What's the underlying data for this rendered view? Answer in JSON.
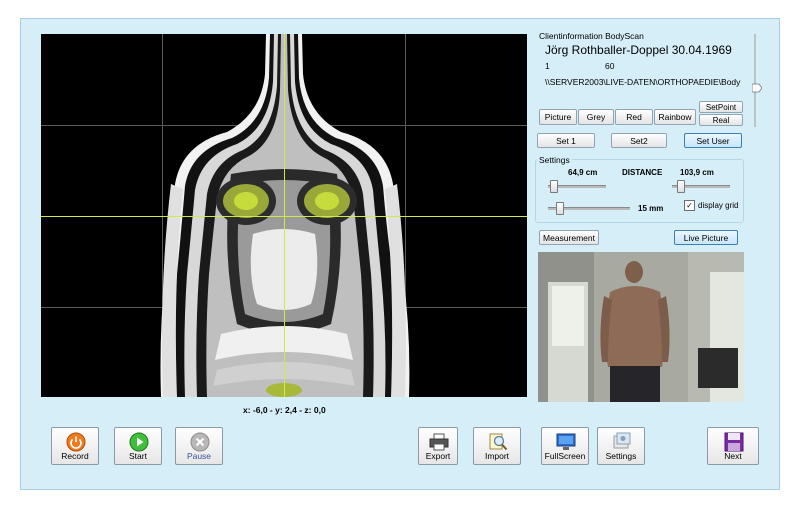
{
  "client_info": {
    "title": "Clientinformation BodyScan",
    "name": "Jörg Rothballer-Doppel 30.04.1969",
    "field1": "1",
    "field2": "60",
    "path": "\\\\SERVER2003\\LIVE-DATEN\\ORTHOPAEDIE\\Body"
  },
  "view_buttons": {
    "picture": "Picture",
    "grey": "Grey",
    "red": "Red",
    "rainbow": "Rainbow",
    "setpoint": "SetPoint",
    "real": "Real"
  },
  "set_buttons": {
    "set1": "Set 1",
    "set2": "Set2",
    "set_user": "Set User"
  },
  "settings": {
    "title": "Settings",
    "left_value": "64,9 cm",
    "distance_label": "DISTANCE",
    "right_value": "103,9 cm",
    "mm_value": "15 mm",
    "display_grid_label": "display grid",
    "display_grid_checked": true
  },
  "mode_buttons": {
    "measurement": "Measurement",
    "live_picture": "Live Picture"
  },
  "coords": "x: -6,0 - y: 2,4 - z: 0,0",
  "toolbar": {
    "record": "Record",
    "start": "Start",
    "pause": "Pause",
    "export": "Export",
    "import": "Import",
    "fullscreen": "FullScreen",
    "settings": "Settings",
    "next": "Next"
  },
  "colors": {
    "accent": "#cfe84a",
    "background": "#d6eef8"
  }
}
